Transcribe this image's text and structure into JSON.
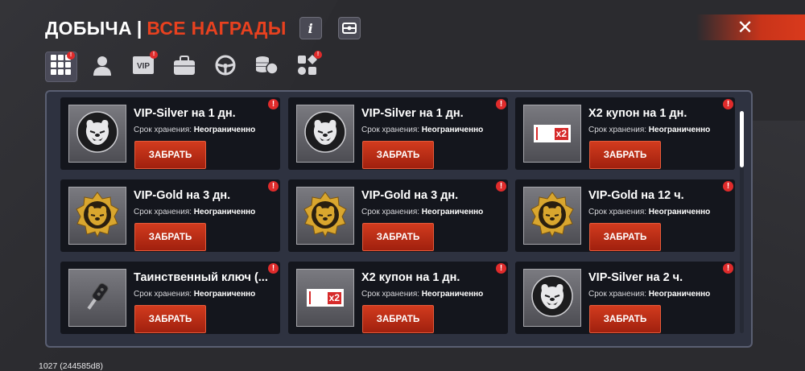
{
  "header": {
    "title": "ДОБЫЧА",
    "separator": "|",
    "subtitle": "ВСЕ НАГРАДЫ",
    "info_label": "i"
  },
  "tabs": [
    {
      "id": "all",
      "icon": "grid-icon",
      "active": true,
      "badge": "!"
    },
    {
      "id": "profile",
      "icon": "person-icon",
      "active": false,
      "badge": ""
    },
    {
      "id": "vip",
      "icon": "vip-icon",
      "label": "VIP",
      "active": false,
      "badge": "!"
    },
    {
      "id": "items",
      "icon": "bag-icon",
      "active": false,
      "badge": ""
    },
    {
      "id": "vehicles",
      "icon": "steering-wheel-icon",
      "active": false,
      "badge": ""
    },
    {
      "id": "money",
      "icon": "coins-icon",
      "active": false,
      "badge": ""
    },
    {
      "id": "other",
      "icon": "shapes-icon",
      "active": false,
      "badge": "!"
    }
  ],
  "rewards": [
    {
      "name": "VIP-Silver на 1 дн.",
      "storage_label": "Срок хранения:",
      "storage_value": "Неограниченно",
      "button": "ЗАБРАТЬ",
      "icon": "silver-bear-icon",
      "alert": "!"
    },
    {
      "name": "VIP-Silver на 1 дн.",
      "storage_label": "Срок хранения:",
      "storage_value": "Неограниченно",
      "button": "ЗАБРАТЬ",
      "icon": "silver-bear-icon",
      "alert": "!"
    },
    {
      "name": "X2 купон на 1 дн.",
      "storage_label": "Срок хранения:",
      "storage_value": "Неограниченно",
      "button": "ЗАБРАТЬ",
      "icon": "x2-coupon-icon",
      "coupon_text": "x2",
      "alert": "!"
    },
    {
      "name": "VIP-Gold на 3 дн.",
      "storage_label": "Срок хранения:",
      "storage_value": "Неограниченно",
      "button": "ЗАБРАТЬ",
      "icon": "gold-bear-icon",
      "alert": "!"
    },
    {
      "name": "VIP-Gold на 3 дн.",
      "storage_label": "Срок хранения:",
      "storage_value": "Неограниченно",
      "button": "ЗАБРАТЬ",
      "icon": "gold-bear-icon",
      "alert": "!"
    },
    {
      "name": "VIP-Gold на 12 ч.",
      "storage_label": "Срок хранения:",
      "storage_value": "Неограниченно",
      "button": "ЗАБРАТЬ",
      "icon": "gold-bear-icon",
      "alert": "!"
    },
    {
      "name": "Таинственный ключ (...",
      "storage_label": "Срок хранения:",
      "storage_value": "Неограниченно",
      "button": "ЗАБРАТЬ",
      "icon": "car-key-icon",
      "alert": "!"
    },
    {
      "name": "X2 купон на 1 дн.",
      "storage_label": "Срок хранения:",
      "storage_value": "Неограниченно",
      "button": "ЗАБРАТЬ",
      "icon": "x2-coupon-icon",
      "coupon_text": "x2",
      "alert": "!"
    },
    {
      "name": "VIP-Silver на 2 ч.",
      "storage_label": "Срок хранения:",
      "storage_value": "Неограниченно",
      "button": "ЗАБРАТЬ",
      "icon": "silver-bear-icon",
      "alert": "!"
    }
  ],
  "footer": {
    "build": "1027 (244585d8)"
  },
  "colors": {
    "accent": "#e8411f",
    "button": "#c0311a",
    "alert": "#e02b2b",
    "panel": "#2e3240",
    "card": "#14161d"
  }
}
